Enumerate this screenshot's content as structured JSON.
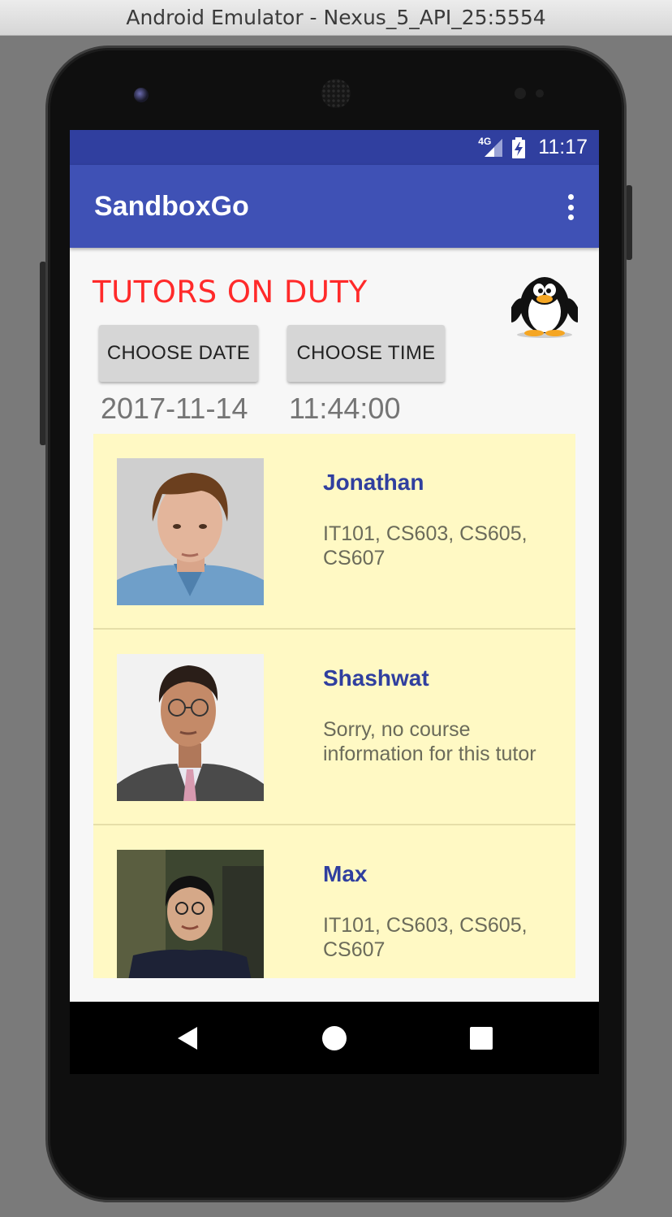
{
  "window": {
    "title": "Android Emulator - Nexus_5_API_25:5554"
  },
  "status_bar": {
    "network": "4G",
    "time": "11:17",
    "icons": [
      "signal-icon",
      "battery-charging-icon"
    ]
  },
  "app_bar": {
    "title": "SandboxGo",
    "menu_icon": "overflow-menu-icon"
  },
  "header": {
    "title": "TUTORS ON DUTY",
    "mascot": "penguin-icon"
  },
  "actions": {
    "choose_date": "CHOOSE DATE",
    "choose_time": "CHOOSE TIME"
  },
  "selection": {
    "date": "2017-11-14",
    "time": "11:44:00"
  },
  "tutors": [
    {
      "name": "Jonathan",
      "courses": "IT101, CS603, CS605, CS607"
    },
    {
      "name": "Shashwat",
      "courses": "Sorry, no course information for this tutor"
    },
    {
      "name": "Max",
      "courses": "IT101, CS603, CS605, CS607"
    }
  ],
  "nav_bar": {
    "back": "back-icon",
    "home": "home-icon",
    "recents": "recents-icon"
  },
  "colors": {
    "status_bar": "#303f9f",
    "app_bar": "#3f51b5",
    "heading": "#ff2a2a",
    "list_background": "#fff9c4",
    "tutor_name": "#303f9f"
  }
}
